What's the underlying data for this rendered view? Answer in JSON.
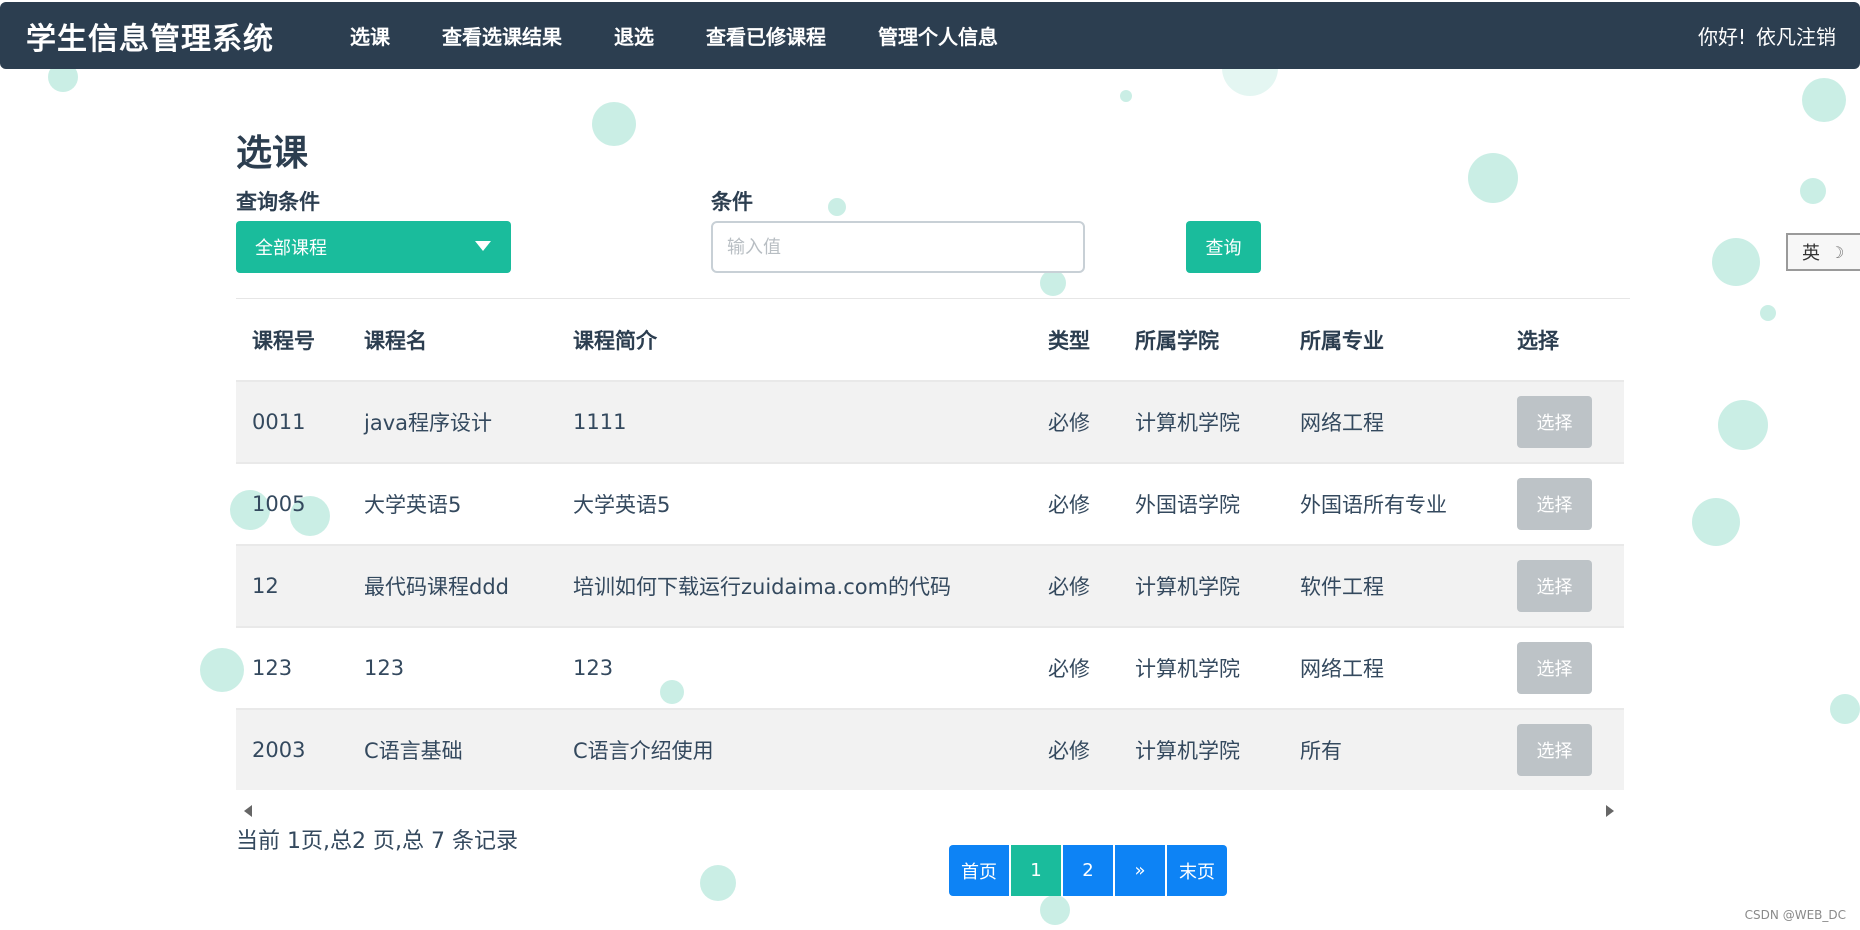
{
  "navbar": {
    "brand": "学生信息管理系统",
    "items": [
      {
        "label": "选课"
      },
      {
        "label": "查看选课结果"
      },
      {
        "label": "退选"
      },
      {
        "label": "查看已修课程"
      },
      {
        "label": "管理个人信息"
      }
    ],
    "greeting": "你好!",
    "username": "依凡",
    "logout": "注销"
  },
  "page": {
    "title": "选课",
    "filter_label": "查询条件",
    "filter_value": "全部课程",
    "condition_label": "条件",
    "condition_placeholder": "输入值",
    "query_button": "查询"
  },
  "table": {
    "headers": [
      "课程号",
      "课程名",
      "课程简介",
      "类型",
      "所属学院",
      "所属专业",
      "选择"
    ],
    "rows": [
      [
        "0011",
        "java程序设计",
        "1111",
        "必修",
        "计算机学院",
        "网络工程"
      ],
      [
        "1005",
        "大学英语5",
        "大学英语5",
        "必修",
        "外国语学院",
        "外国语所有专业"
      ],
      [
        "12",
        "最代码课程ddd",
        "培训如何下载运行zuidaima.com的代码",
        "必修",
        "计算机学院",
        "软件工程"
      ],
      [
        "123",
        "123",
        "123",
        "必修",
        "计算机学院",
        "网络工程"
      ],
      [
        "2003",
        "C语言基础",
        "C语言介绍使用",
        "必修",
        "计算机学院",
        "所有"
      ]
    ],
    "select_label": "选择"
  },
  "record_info": "当前 1页,总2 页,总 7 条记录",
  "pagination": {
    "first": "首页",
    "pages": [
      "1",
      "2"
    ],
    "current": "1",
    "next": "»",
    "last": "末页"
  },
  "ime": {
    "label": "英"
  },
  "watermark": "CSDN @WEB_DC",
  "colors": {
    "navbar": "#2c3e50",
    "accent": "#1abc9c",
    "page_button": "#0d83f5",
    "disabled_button": "#bdc3c7"
  }
}
